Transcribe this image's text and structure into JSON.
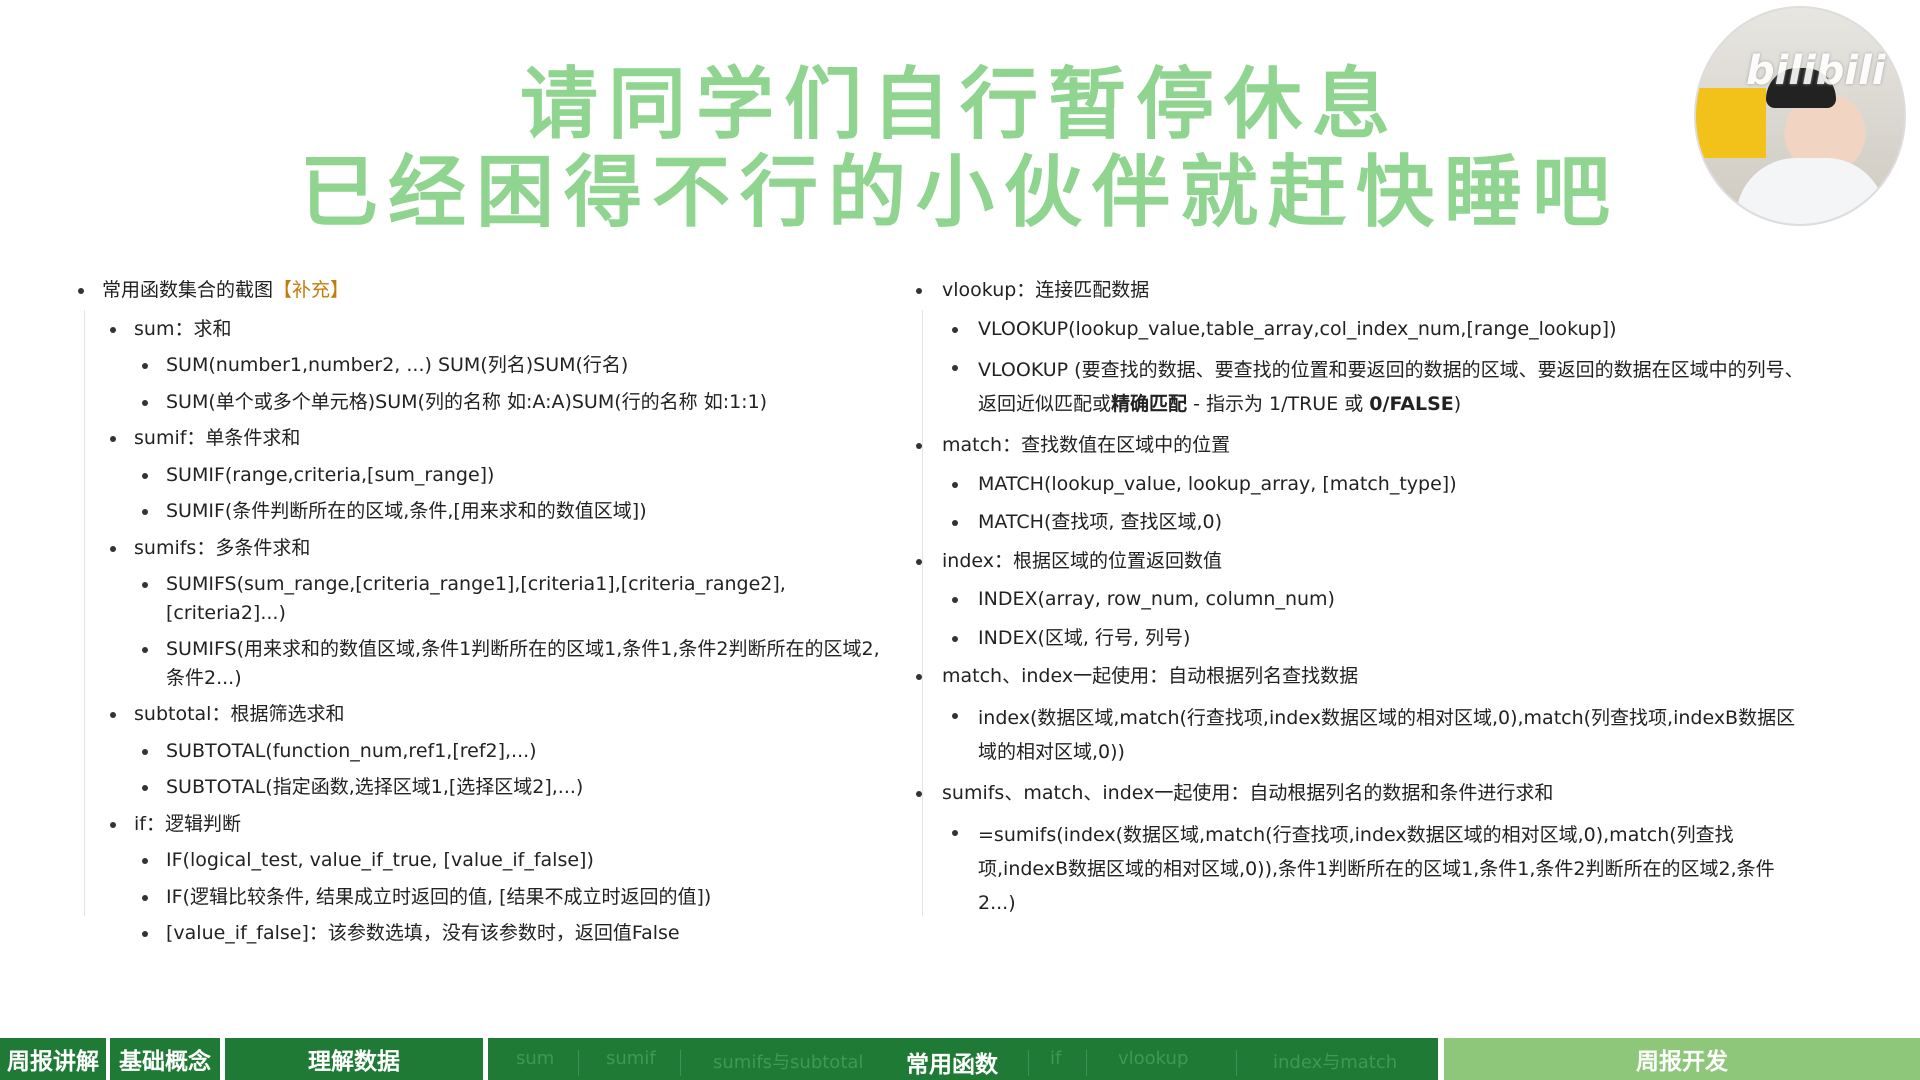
{
  "banner": {
    "line1": "请同学们自行暂停休息",
    "line2": "已经困得不行的小伙伴就赶快睡吧"
  },
  "webcam": {
    "watermark": "bilibili"
  },
  "left": {
    "heading": "常用函数集合的截图",
    "heading_tag": "【补充】",
    "sum_title": "sum：求和",
    "sum_1": "SUM(number1,number2, ...) SUM(列名)SUM(行名)",
    "sum_2": "SUM(单个或多个单元格)SUM(列的名称 如:A:A)SUM(行的名称 如:1:1)",
    "sumif_title": "sumif：单条件求和",
    "sumif_1": "SUMIF(range,criteria,[sum_range])",
    "sumif_2": "SUMIF(条件判断所在的区域,条件,[用来求和的数值区域])",
    "sumifs_title": "sumifs：多条件求和",
    "sumifs_1": "SUMIFS(sum_range,[criteria_range1],[criteria1],[criteria_range2],[criteria2]...)",
    "sumifs_2": "SUMIFS(用来求和的数值区域,条件1判断所在的区域1,条件1,条件2判断所在的区域2,条件2...)",
    "subtotal_title": "subtotal：根据筛选求和",
    "subtotal_1": "SUBTOTAL(function_num,ref1,[ref2],...)",
    "subtotal_2": "SUBTOTAL(指定函数,选择区域1,[选择区域2],...)",
    "if_title": "if：逻辑判断",
    "if_1": "IF(logical_test, value_if_true, [value_if_false])",
    "if_2": "IF(逻辑比较条件, 结果成立时返回的值, [结果不成立时返回的值])",
    "if_3": "[value_if_false]：该参数选填，没有该参数时，返回值False"
  },
  "right": {
    "vlookup_title": "vlookup：连接匹配数据",
    "vlookup_1": "VLOOKUP(lookup_value,table_array,col_index_num,[range_lookup])",
    "vlookup_2a": "VLOOKUP (要查找的数据、要查找的位置和要返回的数据的区域、要返回的数据在区域中的列号、返回近似匹配或",
    "vlookup_2b": "精确匹配",
    "vlookup_2c": " - 指示为 1/TRUE 或 ",
    "vlookup_2d": "0/FALSE",
    "vlookup_2e": ")",
    "match_title": "match：查找数值在区域中的位置",
    "match_1": "MATCH(lookup_value, lookup_array, [match_type])",
    "match_2": "MATCH(查找项, 查找区域,0)",
    "index_title": "index：根据区域的位置返回数值",
    "index_1": "INDEX(array, row_num, column_num)",
    "index_2": "INDEX(区域, 行号, 列号)",
    "mi_title": "match、index一起使用：自动根据列名查找数据",
    "mi_1": "index(数据区域,match(行查找项,index数据区域的相对区域,0),match(列查找项,indexB数据区域的相对区域,0))",
    "smi_title": "sumifs、match、index一起使用：自动根据列名的数据和条件进行求和",
    "smi_1": "=sumifs(index(数据区域,match(行查找项,index数据区域的相对区域,0),match(列查找项,indexB数据区域的相对区域,0)),条件1判断所在的区域1,条件1,条件2判断所在的区域2,条件2...)"
  },
  "nav": {
    "seg1": "周报讲解",
    "seg2": "基础概念",
    "seg3": "理解数据",
    "sub": [
      "sum",
      "sumif",
      "sumifs与subtotal",
      "常用函数",
      "if",
      "vlookup",
      "index与match"
    ],
    "seg5": "周报开发",
    "colors": {
      "dark": "#1e7a35",
      "light": "#8ec77a",
      "banner": "#8fd48f"
    }
  }
}
